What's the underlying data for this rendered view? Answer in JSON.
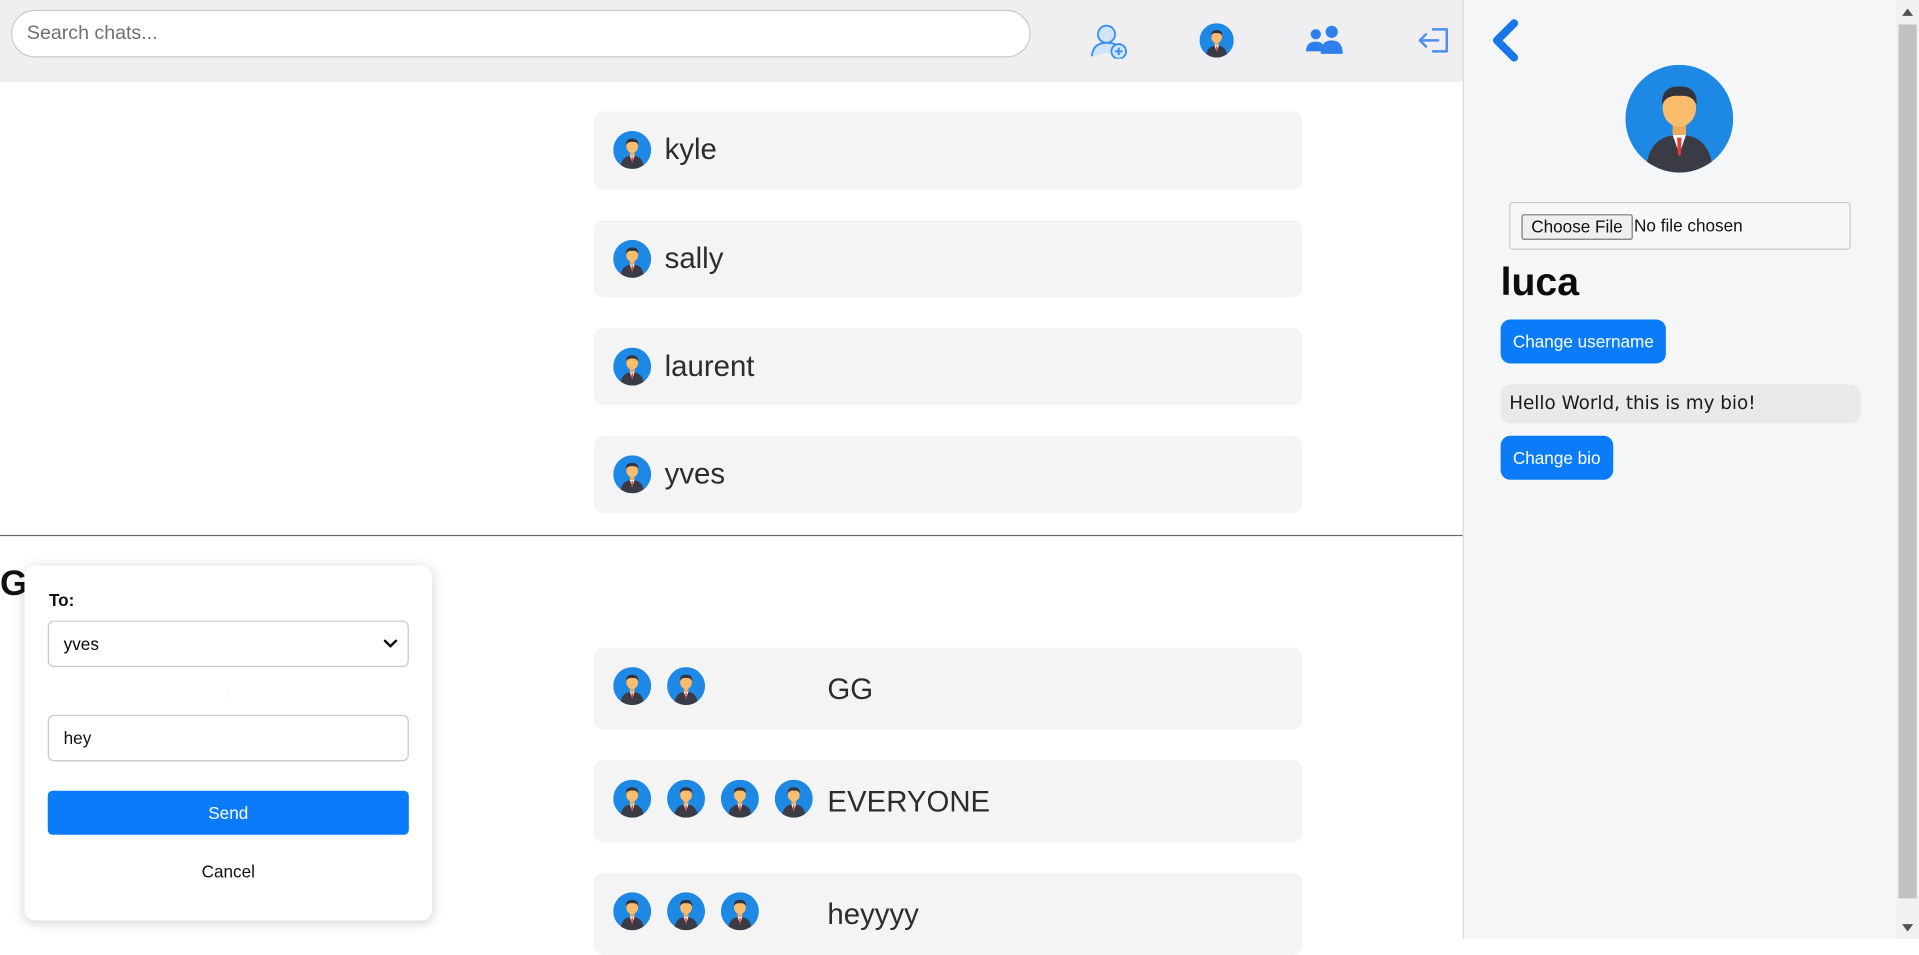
{
  "header": {
    "search_placeholder": "Search chats...",
    "icons": [
      "add-user-icon",
      "profile-avatar-icon",
      "group-icon",
      "logout-icon"
    ]
  },
  "chats": [
    {
      "name": "kyle",
      "avatars": 1
    },
    {
      "name": "sally",
      "avatars": 1
    },
    {
      "name": "laurent",
      "avatars": 1
    },
    {
      "name": "yves",
      "avatars": 1
    }
  ],
  "groups_heading": "G",
  "groups": [
    {
      "name": "GG",
      "avatars": 2
    },
    {
      "name": "EVERYONE",
      "avatars": 4
    },
    {
      "name": "heyyyy",
      "avatars": 3
    }
  ],
  "new_message": {
    "to_label": "To:",
    "recipient": "yves",
    "message": "hey",
    "send_label": "Send",
    "cancel_label": "Cancel"
  },
  "profile": {
    "choose_file_label": "Choose File",
    "file_status": "No file chosen",
    "username": "luca",
    "change_username_label": "Change username",
    "bio": "Hello World, this is my bio!",
    "change_bio_label": "Change bio"
  },
  "colors": {
    "accent": "#0a7cfa",
    "avatar_bg": "#1e88e5",
    "header_bg": "#efeff1",
    "chat_bg": "#f4f4f4",
    "panel_bg": "#f5f6f8"
  }
}
